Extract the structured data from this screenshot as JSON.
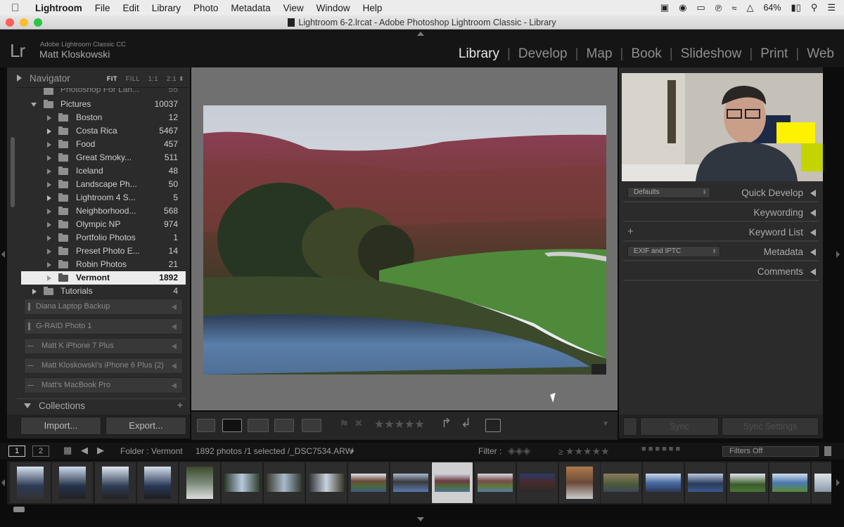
{
  "menubar": {
    "app": "Lightroom",
    "items": [
      "File",
      "Edit",
      "Library",
      "Photo",
      "Metadata",
      "View",
      "Window",
      "Help"
    ],
    "battery": "64%"
  },
  "window": {
    "title": "Lightroom 6-2.lrcat - Adobe Photoshop Lightroom Classic - Library"
  },
  "identity": {
    "logo": "Lr",
    "product": "Adobe Lightroom Classic CC",
    "user": "Matt Kloskowski"
  },
  "modules": [
    "Library",
    "Develop",
    "Map",
    "Book",
    "Slideshow",
    "Print",
    "Web"
  ],
  "navigator": {
    "title": "Navigator",
    "zoom": {
      "fit": "FIT",
      "fill": "FILL",
      "one": "1:1",
      "two": "2:1"
    }
  },
  "folders": {
    "partial": {
      "label": "Photoshop For Lan...",
      "count": "55"
    },
    "parent": {
      "label": "Pictures",
      "count": "10037"
    },
    "items": [
      {
        "label": "Boston",
        "count": "12"
      },
      {
        "label": "Costa Rica",
        "count": "5467"
      },
      {
        "label": "Food",
        "count": "457"
      },
      {
        "label": "Great Smoky...",
        "count": "511"
      },
      {
        "label": "Iceland",
        "count": "48"
      },
      {
        "label": "Landscape Ph...",
        "count": "50"
      },
      {
        "label": "Lightroom 4 S...",
        "count": "5"
      },
      {
        "label": "Neighborhood...",
        "count": "568"
      },
      {
        "label": "Olympic NP",
        "count": "974"
      },
      {
        "label": "Portfolio Photos",
        "count": "1"
      },
      {
        "label": "Preset Photo E...",
        "count": "14"
      },
      {
        "label": "Robin Photos",
        "count": "21"
      },
      {
        "label": "Vermont",
        "count": "1892"
      }
    ],
    "sibling": {
      "label": "Tutorials",
      "count": "4"
    }
  },
  "volumes": [
    "Diana Laptop Backup",
    "G-RAID Photo 1",
    "Matt K iPhone 7 Plus",
    "Matt Kloskowski's iPhone 6 Plus (2)",
    "Matt's MacBook Pro"
  ],
  "collections": {
    "title": "Collections",
    "plus": "+"
  },
  "buttons": {
    "import": "Import...",
    "export": "Export...",
    "sync": "Sync",
    "sync_settings": "Sync Settings"
  },
  "right_panel": {
    "quick_develop": {
      "label": "Quick Develop",
      "preset": "Defaults"
    },
    "keywording": "Keywording",
    "keyword_list": {
      "label": "Keyword List",
      "plus": "+"
    },
    "metadata": {
      "label": "Metadata",
      "preset": "EXIF and IPTC"
    },
    "comments": "Comments"
  },
  "filmstrip_bar": {
    "page1": "1",
    "page2": "2",
    "source": "Folder : Vermont",
    "info": "1892 photos /1 selected /_DSC7534.ARW",
    "filter_label": "Filter :",
    "filter_value": "Filters Off"
  },
  "colors": {
    "accent_selected": "#ececec",
    "panel": "#2b2b2b",
    "background": "#0c0c0c"
  }
}
